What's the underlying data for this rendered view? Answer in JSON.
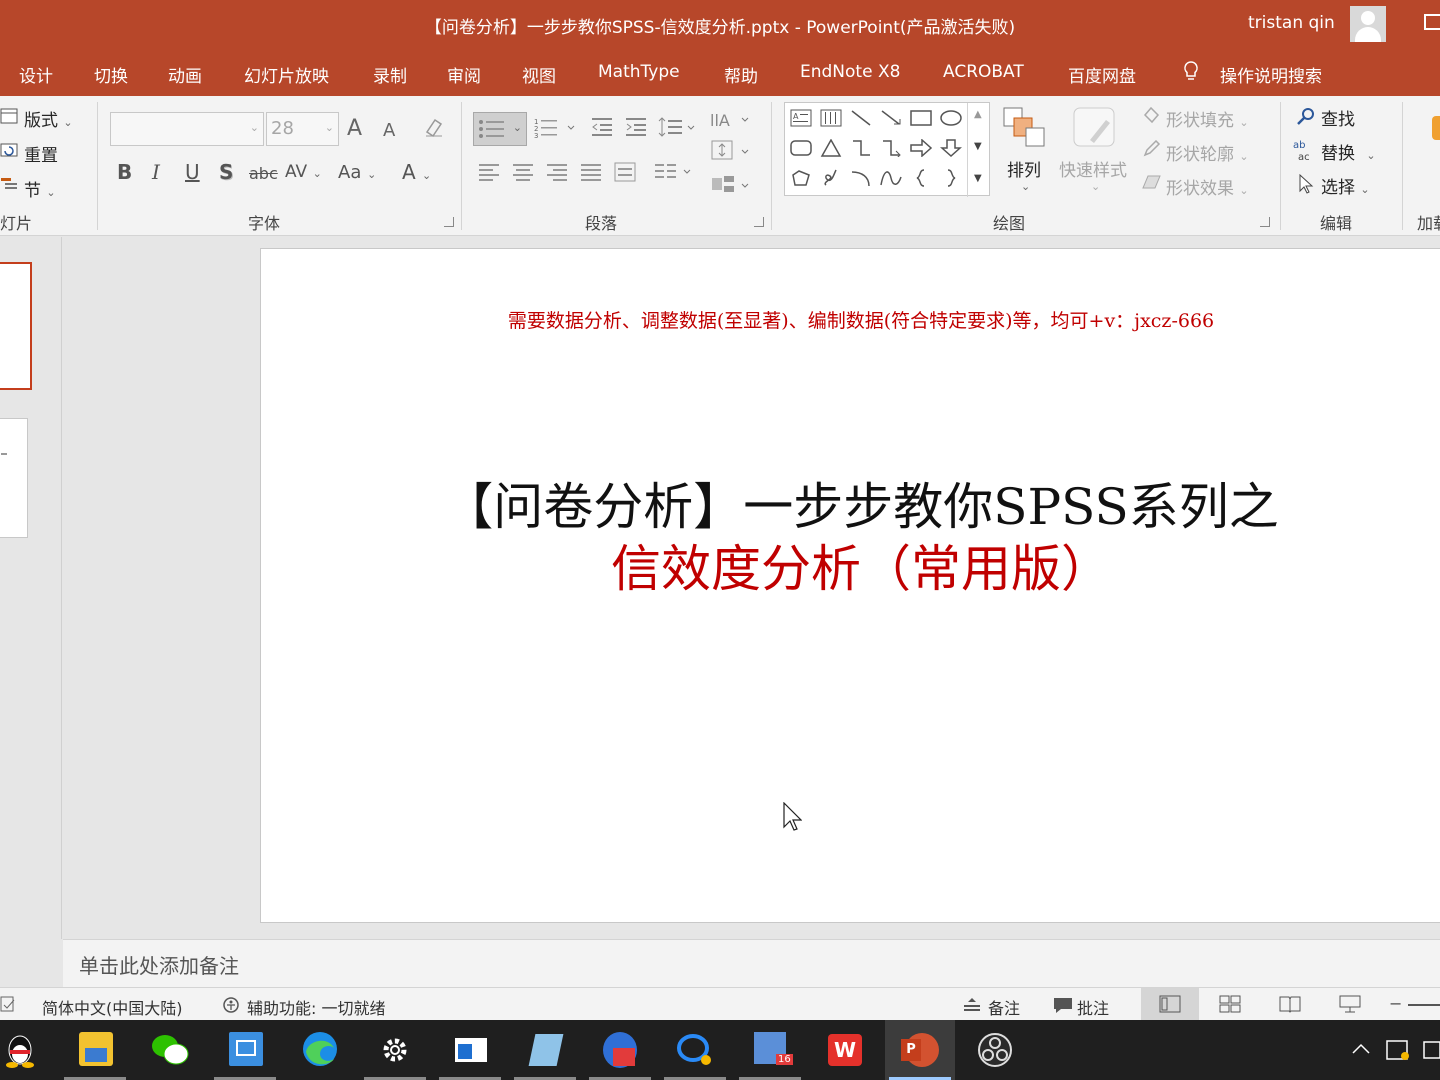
{
  "window": {
    "title": "【问卷分析】一步步教你SPSS-信效度分析.pptx  -  PowerPoint(产品激活失败)",
    "user": "tristan qin"
  },
  "tabs": [
    "设计",
    "切换",
    "动画",
    "幻灯片放映",
    "录制",
    "审阅",
    "视图",
    "MathType",
    "帮助",
    "EndNote X8",
    "ACROBAT",
    "百度网盘"
  ],
  "tell_me": "操作说明搜索",
  "ribbon": {
    "slides_group": {
      "layout": "版式",
      "reset": "重置",
      "section": "节",
      "label": "灯片"
    },
    "font_group": {
      "font_name": "",
      "font_size": "28",
      "label": "字体",
      "grow": "A",
      "shrink": "A",
      "bold": "B",
      "italic": "I",
      "underline": "U",
      "shadow": "S",
      "strike": "abc",
      "spacing": "AV",
      "case": "Aa",
      "color": "A"
    },
    "paragraph_group": {
      "label": "段落"
    },
    "drawing_group": {
      "arrange": "排列",
      "quick_styles": "快速样式",
      "shape_fill": "形状填充",
      "shape_outline": "形状轮廓",
      "shape_effects": "形状效果",
      "label": "绘图"
    },
    "editing_group": {
      "find": "查找",
      "replace": "替换",
      "select": "选择",
      "label": "编辑"
    },
    "addins_group": {
      "label": "加载"
    }
  },
  "slide": {
    "note": "需要数据分析、调整数据(至显著)、编制数据(符合特定要求)等，均可+v：jxcz-666",
    "title_line1": "【问卷分析】一步步教你SPSS系列之",
    "title_line2": "信效度分析（常用版）"
  },
  "notes_placeholder": "单击此处添加备注",
  "status_bar": {
    "language": "简体中文(中国大陆)",
    "accessibility": "辅助功能: 一切就绪",
    "notes": "备注",
    "comments": "批注"
  },
  "taskbar": {
    "apps": [
      "qq-icon",
      "file-explorer-icon",
      "wechat-icon",
      "app-icon",
      "edge-icon",
      "settings-icon",
      "window-app-icon",
      "notepad-icon",
      "calendar-app-icon",
      "chat-app-icon",
      "grid-app-icon",
      "wps-icon",
      "powerpoint-icon",
      "obs-icon"
    ],
    "badge": "16"
  }
}
